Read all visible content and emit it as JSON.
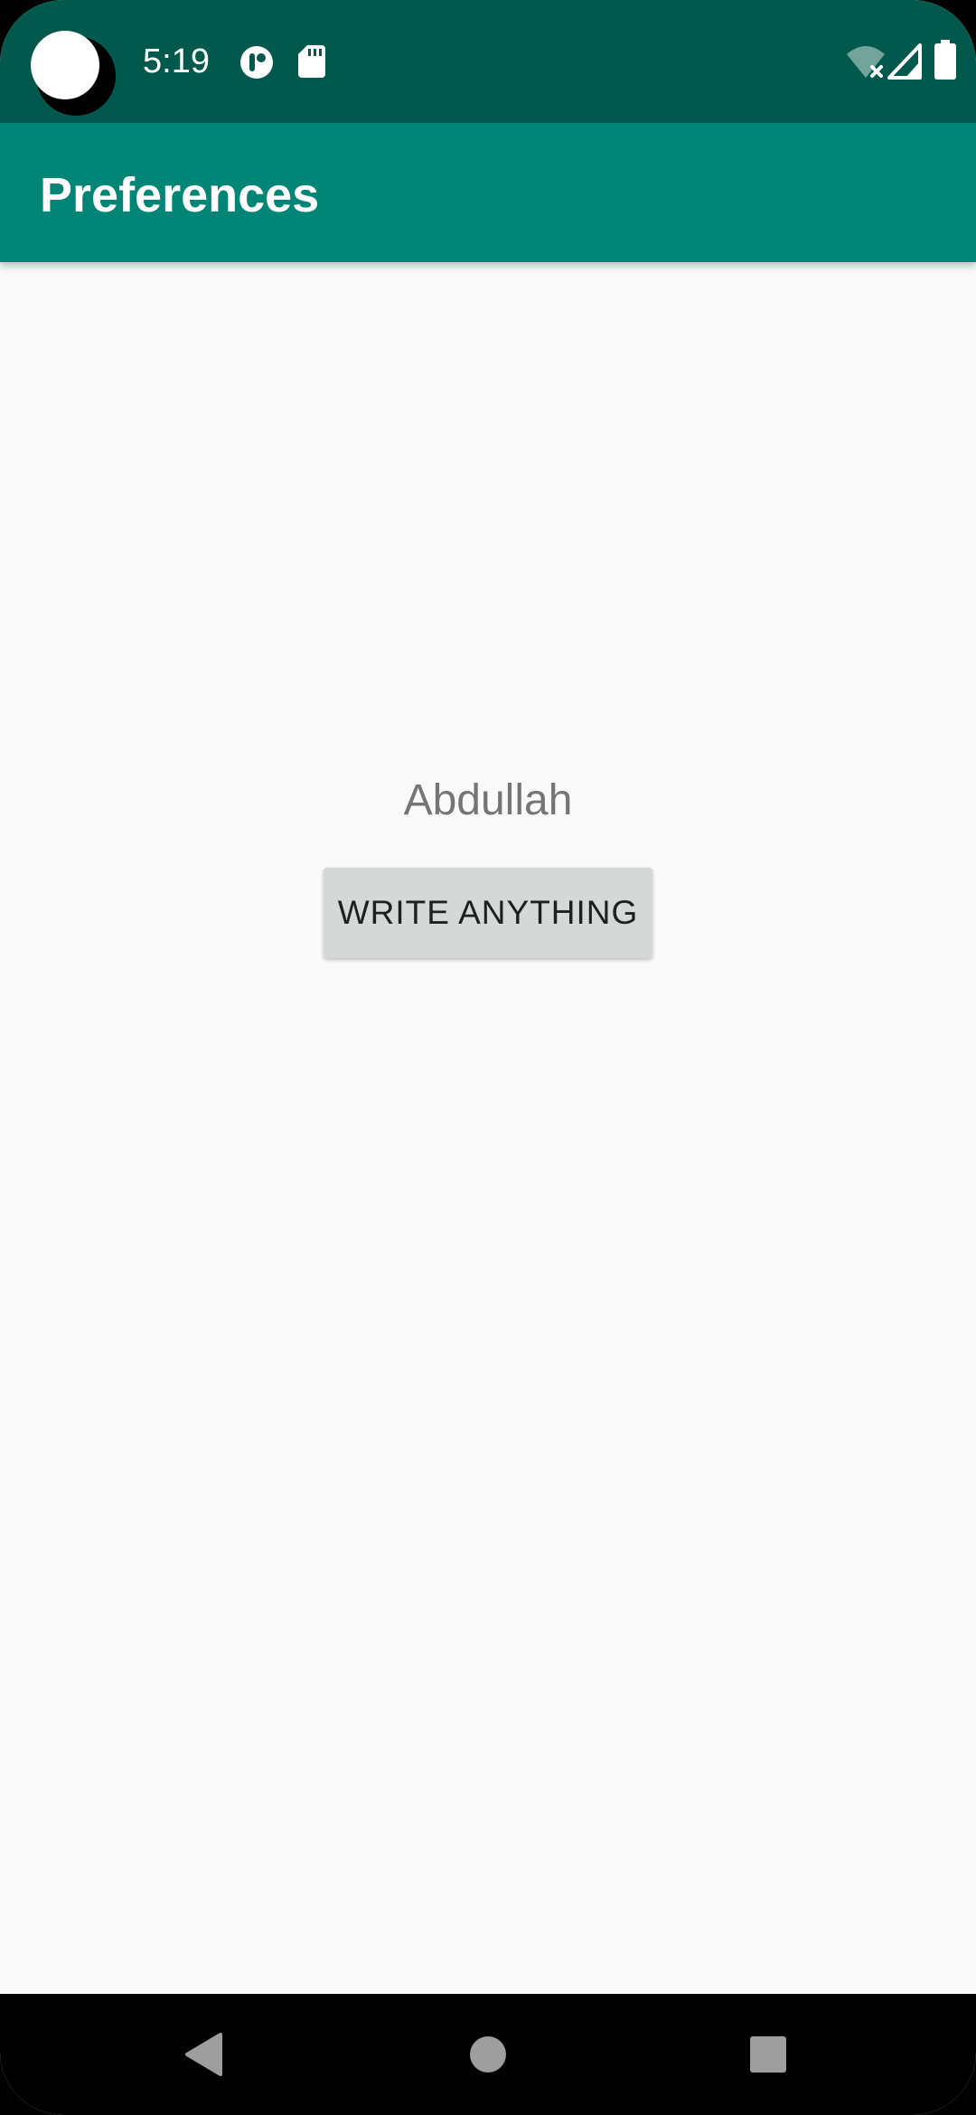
{
  "status_bar": {
    "time": "5:19",
    "icons": [
      "notification-app-icon",
      "sd-card-icon",
      "wifi-off-icon",
      "cell-signal-icon",
      "battery-icon"
    ]
  },
  "app_bar": {
    "title": "Preferences"
  },
  "main": {
    "name_text": "Abdullah",
    "write_button_label": "WRITE ANYTHING"
  },
  "nav_bar": {
    "buttons": [
      "back",
      "home",
      "recents"
    ]
  },
  "colors": {
    "status_bar": "#00594c",
    "app_bar": "#008577",
    "background": "#fafafa",
    "button": "#d6d7d7"
  }
}
